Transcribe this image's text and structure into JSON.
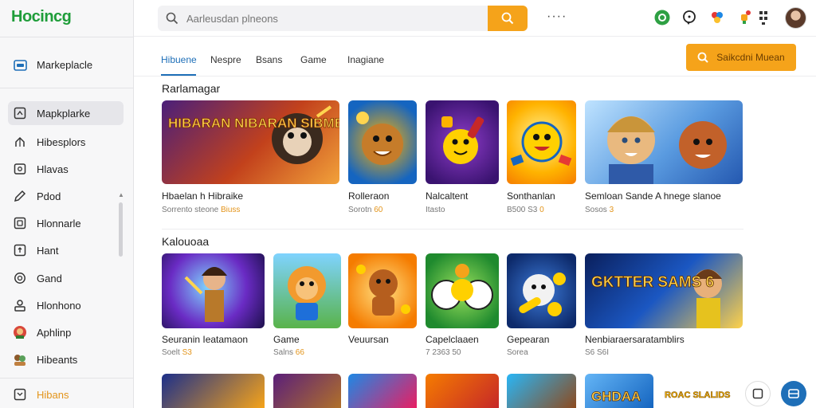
{
  "app": {
    "logo": "Hocincg"
  },
  "sidebar": {
    "top_item": {
      "label": "Markeplacle",
      "icon": "store-icon"
    },
    "items": [
      {
        "label": "Mapkplarke",
        "icon": "grid-icon",
        "active": true
      },
      {
        "label": "Hibesplors",
        "icon": "gift-icon"
      },
      {
        "label": "Hlavas",
        "icon": "image-icon"
      },
      {
        "label": "Pdod",
        "icon": "pencil-icon"
      },
      {
        "label": "Hlonnarle",
        "icon": "frame-icon"
      },
      {
        "label": "Hant",
        "icon": "arrow-box-icon"
      },
      {
        "label": "Gand",
        "icon": "target-icon"
      },
      {
        "label": "Hlonhono",
        "icon": "person-icon"
      },
      {
        "label": "Aphlinp",
        "icon": "avatar-icon"
      },
      {
        "label": "Hibeants",
        "icon": "avatar-group-icon"
      }
    ],
    "bottom_item": {
      "label": "Hibans",
      "icon": "box-icon"
    }
  },
  "search": {
    "placeholder": "Aarleusdan plneons"
  },
  "header": {
    "more": "····"
  },
  "tabs": [
    {
      "label": "Hibuene",
      "active": true
    },
    {
      "label": "Nespre"
    },
    {
      "label": "Bsans"
    },
    {
      "label": "Game"
    },
    {
      "label": "Inagiane"
    }
  ],
  "cta": {
    "label": "Saikcdni Muean"
  },
  "sections": [
    {
      "title": "Rarlamagar",
      "cards": [
        {
          "title": "Hbaelan h Hibraike",
          "meta": "Sorrento steone",
          "meta_hl": "Biuss",
          "art": "HIBARAN NIBARAN SIBMES"
        },
        {
          "title": "Rolleraon",
          "meta": "Sorotn",
          "meta_hl": "60"
        },
        {
          "title": "Nalcaltent",
          "meta": "Itasto",
          "meta_hl": ""
        },
        {
          "title": "Sonthanlan",
          "meta": "B500 S3",
          "meta_hl": "0"
        },
        {
          "title": "Semloan Sande A hnege slanoe",
          "meta": "Sosos",
          "meta_hl": "3"
        }
      ]
    },
    {
      "title": "Kalouoaa",
      "cards": [
        {
          "title": "Seuranin Ieatamaon",
          "meta": "Soelt",
          "meta_hl": "S3"
        },
        {
          "title": "Game",
          "meta": "Salns",
          "meta_hl": "66"
        },
        {
          "title": "Veuursan",
          "meta": "",
          "meta_hl": ""
        },
        {
          "title": "Capelclaaen",
          "meta": "7 2363 50",
          "meta_hl": ""
        },
        {
          "title": "Gepearan",
          "meta": "Sorea",
          "meta_hl": ""
        },
        {
          "title": "Nenbiaraersaratamblirs",
          "meta": "S6 S6I",
          "meta_hl": "",
          "art": "GKTTER SAMS 6"
        }
      ]
    },
    {
      "row3_art": [
        "",
        "",
        "",
        "",
        "",
        "GHDAA",
        "ROAC SLALIDS"
      ]
    }
  ],
  "colors": {
    "accent": "#f5a31a",
    "tab_active": "#1e6fb8",
    "logo": "#1f9d3a"
  }
}
